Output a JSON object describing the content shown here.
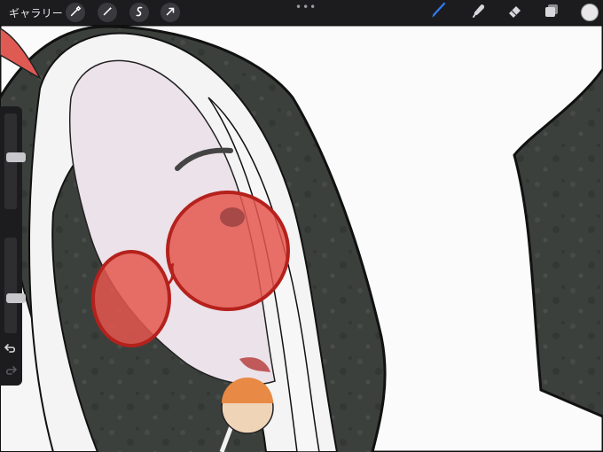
{
  "toolbar": {
    "gallery_label": "ギャラリー",
    "left_tools": [
      {
        "icon": "wrench-icon",
        "name": "actions"
      },
      {
        "icon": "magic-wand-icon",
        "name": "adjustments"
      },
      {
        "icon": "selection-s-icon",
        "name": "selection"
      },
      {
        "icon": "transform-arrow-icon",
        "name": "transform"
      }
    ],
    "more_label": "•••",
    "right_tools": [
      {
        "icon": "brush-icon",
        "name": "paint",
        "active": true
      },
      {
        "icon": "smudge-icon",
        "name": "smudge",
        "active": false
      },
      {
        "icon": "eraser-icon",
        "name": "erase",
        "active": false
      },
      {
        "icon": "layers-icon",
        "name": "layers",
        "active": false
      }
    ],
    "current_color": "#e8e6e8"
  },
  "sidebar": {
    "brush_size_level": 0.55,
    "opacity_level": 0.35
  },
  "colors": {
    "toolbar_bg": "#1c1c1e",
    "active_tool": "#2f7cf6",
    "lens_red": "#e5574f",
    "background_wall": "#3d413d"
  }
}
